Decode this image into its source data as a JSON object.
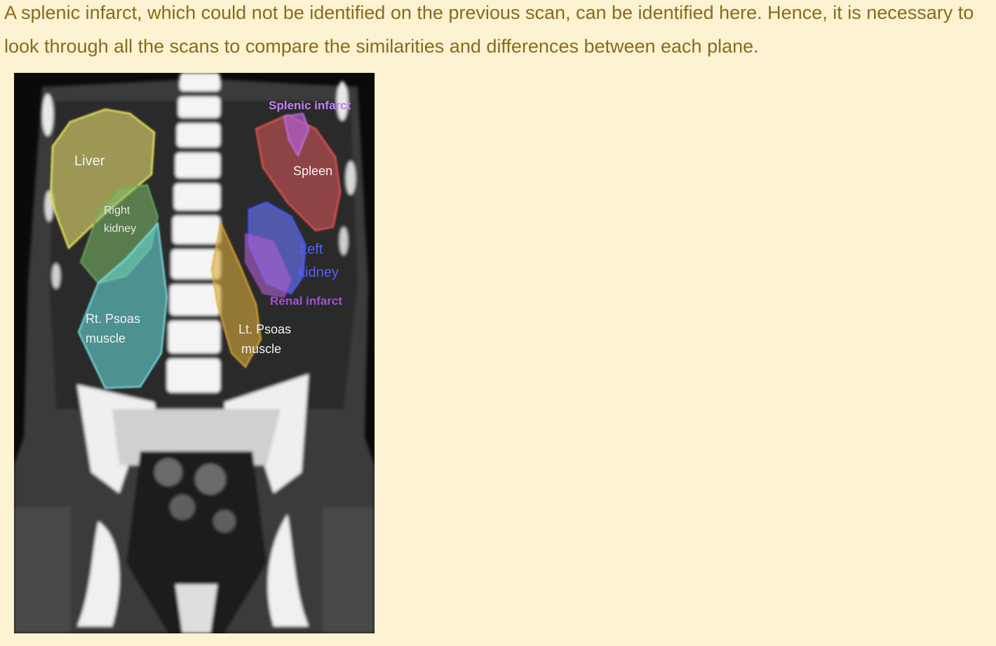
{
  "body_text": "A splenic infarct, which could not be identified on the previous scan, can be identified here. Hence, it is necessary to look through all the scans to compare the similarities and differences between each plane.",
  "figure": {
    "labels": {
      "splenic_infarct": "Splenic infarct",
      "liver": "Liver",
      "spleen": "Spleen",
      "right_kidney_1": "Right",
      "right_kidney_2": "kidney",
      "left_kidney_1": "Left",
      "left_kidney_2": "kidney",
      "renal_infarct": "Renal infarct",
      "rt_psoas_1": "Rt. Psoas",
      "rt_psoas_2": "muscle",
      "lt_psoas_1": "Lt. Psoas",
      "lt_psoas_2": "muscle"
    },
    "colors": {
      "page_background": "#fdf3d2",
      "text": "#8a6a1d",
      "liver": "#d8d36a",
      "right_kidney": "#7fbf6a",
      "rt_psoas": "#66d6d6",
      "lt_psoas": "#d8aa3a",
      "spleen": "#e05a5a",
      "splenic_infarct": "#b060d0",
      "left_kidney": "#6a78ff",
      "renal_infarct": "#b060d0"
    }
  }
}
